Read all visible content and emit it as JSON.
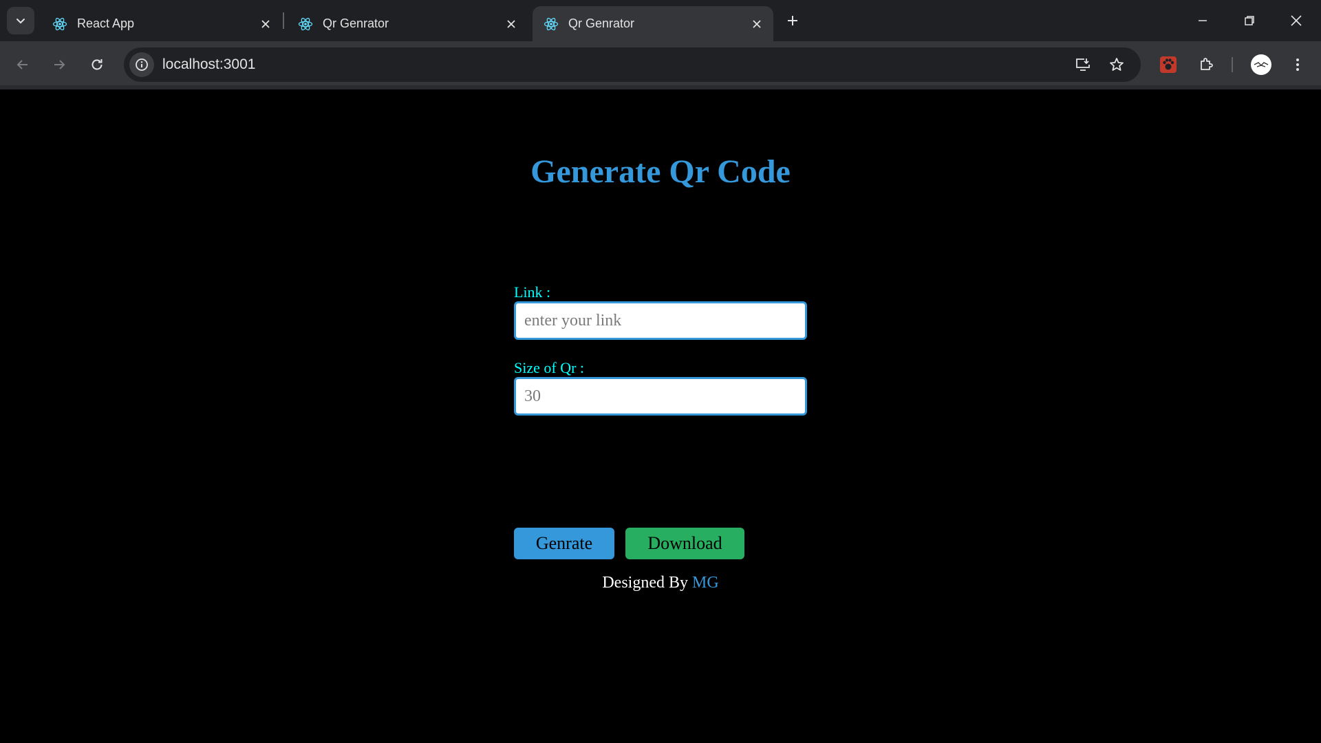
{
  "browser": {
    "tabs": [
      {
        "title": "React App",
        "favicon": "react-icon",
        "active": false
      },
      {
        "title": "Qr Genrator",
        "favicon": "react-icon",
        "active": false
      },
      {
        "title": "Qr Genrator",
        "favicon": "react-icon",
        "active": true
      }
    ],
    "address_bar": {
      "url": "localhost:3001"
    },
    "colors": {
      "tabstrip": "#1f2023",
      "toolbar": "#35363a",
      "omnibox": "#202124"
    }
  },
  "page": {
    "title": "Generate Qr Code",
    "link_field": {
      "label": "Link :",
      "placeholder": "enter your link",
      "value": ""
    },
    "size_field": {
      "label": "Size of Qr :",
      "value": "30"
    },
    "buttons": {
      "generate": "Genrate",
      "download": "Download"
    },
    "footer": {
      "text": "Designed By",
      "author": "MG"
    },
    "colors": {
      "background": "#000000",
      "title": "#3498db",
      "label": "#00ffff",
      "generate_button": "#3498db",
      "download_button": "#27ae60",
      "author_link": "#3498db"
    }
  }
}
